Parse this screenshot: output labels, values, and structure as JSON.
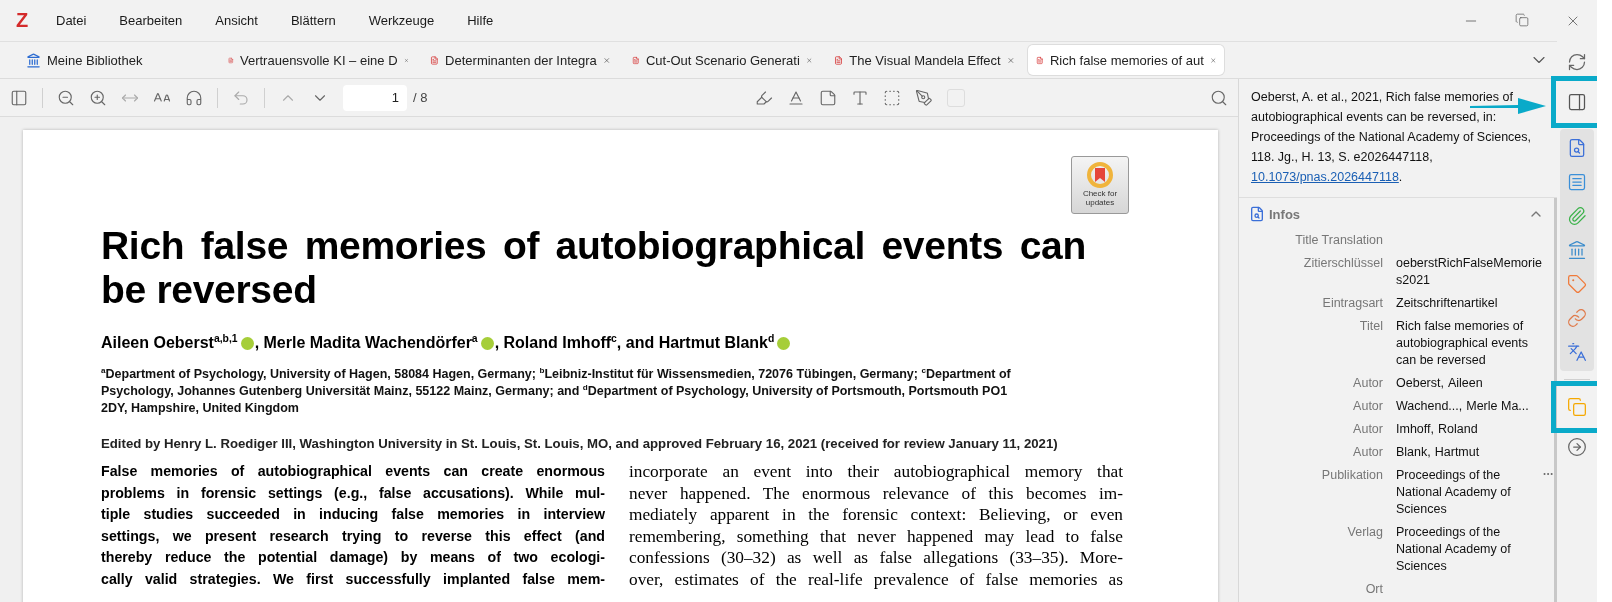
{
  "app_logo": "Z",
  "menu": [
    "Datei",
    "Bearbeiten",
    "Ansicht",
    "Blättern",
    "Werkzeuge",
    "Hilfe"
  ],
  "tabs": [
    {
      "kind": "library",
      "label": "Meine Bibliothek",
      "selected": false
    },
    {
      "kind": "pdf",
      "label": "Vertrauensvolle KI – eine D",
      "selected": false
    },
    {
      "kind": "pdf",
      "label": "Determinanten der Integra",
      "selected": false
    },
    {
      "kind": "pdf",
      "label": "Cut-Out Scenario Generati",
      "selected": false
    },
    {
      "kind": "pdf",
      "label": "The Visual Mandela Effect",
      "selected": false
    },
    {
      "kind": "pdf",
      "label": "Rich false memories of aut",
      "selected": true
    }
  ],
  "toolbar": {
    "page": "1",
    "page_count": "/ 8"
  },
  "document": {
    "badge": "Check for updates",
    "title_lines": [
      "Rich false memories of autobiographical events can",
      "be reversed"
    ],
    "authors": [
      {
        "text": "Aileen Oeberst$^{a,b,1}$",
        "orcid": true
      },
      {
        "text": ", Merle Madita Wachendörfer$^{a}$",
        "orcid": true
      },
      {
        "text": ", Roland Imhoff$^{c}$",
        "orcid": false
      },
      {
        "text": ", and Hartmut Blank$^{d}$",
        "orcid": true
      }
    ],
    "affiliation_lines": [
      "$^{a}$Department of Psychology, University of Hagen, 58084 Hagen, Germany; $^{b}$Leibniz-Institut für Wissensmedien, 72076 Tübingen, Germany; $^{c}$Department of",
      "Psychology, Johannes Gutenberg Universität Mainz, 55122 Mainz, Germany; and $^{d}$Department of Psychology, University of Portsmouth, Portsmouth PO1",
      "2DY, Hampshire, United Kingdom"
    ],
    "edited_by": "Edited by Henry L. Roediger III, Washington University in St. Louis, St. Louis, MO, and approved February 16, 2021 (received for review January 11, 2021)",
    "abstract_lines": [
      "False memories of autobiographical events can create enormous",
      "problems in forensic settings (e.g., false accusations). While mul-",
      "tiple studies succeeded in inducing false memories in interview",
      "settings, we present research trying to reverse this effect (and",
      "thereby reduce the potential damage) by means of two ecologi-",
      "cally valid strategies. We first successfully implanted false mem-"
    ],
    "body_lines": [
      "incorporate an event into their autobiographical memory that",
      "never happened. The enormous relevance of this becomes im-",
      "mediately apparent in the forensic context: Believing, or even",
      "remembering, something that never happened may lead to false",
      "confessions (30–32) as well as false allegations (33–35). More-",
      "over, estimates of the real-life prevalence of false memories as"
    ]
  },
  "item_pane": {
    "citation": "Oeberst, A. et al., 2021, Rich false memories of autobiographical events can be reversed, in: Proceedings of the National Academy of Sciences, 118. Jg., H. 13, S. e2026447118, ",
    "citation_link": "10.1073/pnas.2026447118",
    "citation_end": ".",
    "section_title": "Infos",
    "expanded": true,
    "fields": [
      {
        "kind": "text",
        "label": "Title Translation"
      },
      {
        "kind": "text",
        "label": "Zitierschlüssel",
        "value": "oeberstRichFalseMemories2021"
      },
      {
        "kind": "text",
        "label": "Eintragsart",
        "value": "Zeitschriftenartikel"
      },
      {
        "kind": "text",
        "label": "Titel",
        "value": "Rich false memories of autobiographical events can be reversed"
      },
      {
        "kind": "creator",
        "label": "Autor",
        "last": "Oeberst,",
        "first": "Aileen"
      },
      {
        "kind": "creator",
        "label": "Autor",
        "last": "Wachend...,",
        "first": "Merle Ma..."
      },
      {
        "kind": "creator",
        "label": "Autor",
        "last": "Imhoff,",
        "first": "Roland"
      },
      {
        "kind": "creator",
        "label": "Autor",
        "last": "Blank,",
        "first": "Hartmut"
      },
      {
        "kind": "text",
        "label": "Publikation",
        "value": "Proceedings of the National Academy of Sciences",
        "menu": true
      },
      {
        "kind": "text",
        "label": "Verlag",
        "value": "Proceedings of the National Academy of Sciences"
      },
      {
        "kind": "text",
        "label": "Ort"
      }
    ]
  },
  "sidebar": {
    "top": [
      {
        "kind": "sync"
      },
      {
        "kind": "toggle-pane",
        "annotated": true
      }
    ],
    "sections": [
      {
        "kind": "info"
      },
      {
        "kind": "abstract"
      },
      {
        "kind": "attachments"
      },
      {
        "kind": "libraries"
      },
      {
        "kind": "tags"
      },
      {
        "kind": "related"
      },
      {
        "kind": "translate"
      }
    ],
    "tools": [
      {
        "kind": "notes",
        "annotated": true
      },
      {
        "kind": "locate"
      }
    ]
  }
}
